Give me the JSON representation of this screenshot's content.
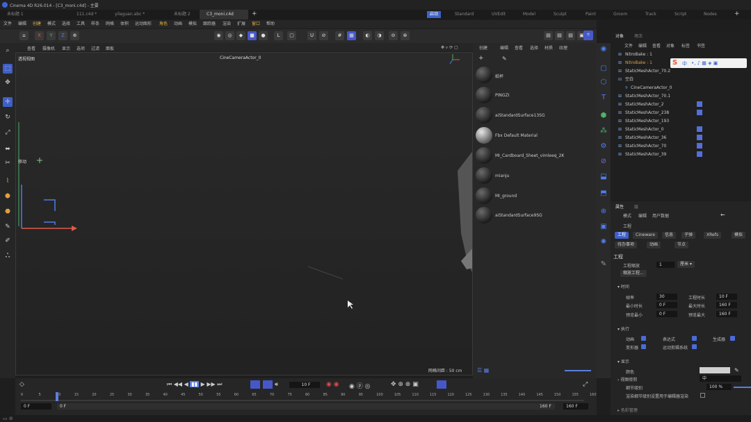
{
  "window_title": "Cinema 4D R26.014 - [C3_moni.c4d] - 主要",
  "doc_tabs": [
    {
      "label": "未标题 1",
      "active": false
    },
    {
      "label": "111.c4d *",
      "active": false
    },
    {
      "label": "yilaguan.abc *",
      "active": false
    },
    {
      "label": "未标题 2",
      "active": false
    },
    {
      "label": "C3_moni.c4d",
      "active": true
    }
  ],
  "layouts": [
    {
      "label": "启动",
      "active": true
    },
    {
      "label": "Standard",
      "active": false
    },
    {
      "label": "UVEdit",
      "active": false
    },
    {
      "label": "Model",
      "active": false
    },
    {
      "label": "Sculpt",
      "active": false
    },
    {
      "label": "Paint",
      "active": false
    },
    {
      "label": "Groom",
      "active": false
    },
    {
      "label": "Track",
      "active": false
    },
    {
      "label": "Script",
      "active": false
    },
    {
      "label": "Nodes",
      "active": false
    }
  ],
  "menu": [
    "文件",
    "编辑",
    "创建",
    "模式",
    "选择",
    "工具",
    "样条",
    "网格",
    "体积",
    "运动图形",
    "角色",
    "动画",
    "模拟",
    "跟踪器",
    "渲染",
    "扩展",
    "窗口",
    "帮助"
  ],
  "axis_labels": {
    "x": "X",
    "y": "Y",
    "z": "Z"
  },
  "viewport": {
    "menu": [
      "查看",
      "摄像机",
      "显示",
      "选项",
      "过滤",
      "面板"
    ],
    "title": "透视视图",
    "camera": "CineCameraActor_0",
    "grid_spacing": "网格间距 : 50 cm",
    "move_label": "移动"
  },
  "material_menu": [
    "创建",
    "编辑",
    "查看",
    "选择",
    "材质",
    "纹理"
  ],
  "materials": [
    {
      "name": "纸杯",
      "light": false
    },
    {
      "name": "PINGZI",
      "light": false
    },
    {
      "name": "aiStandardSurface13SG",
      "light": false
    },
    {
      "name": "Fbx Default Material",
      "light": true
    },
    {
      "name": "MI_Cardboard_Sheet_vimleeq_2K",
      "light": false
    },
    {
      "name": "mianju",
      "light": false
    },
    {
      "name": "MI_ground",
      "light": false
    },
    {
      "name": "aiStandardSurface9SG",
      "light": false
    }
  ],
  "object_panel": {
    "tabs": [
      "对象",
      "场次"
    ],
    "menu": [
      "文件",
      "编辑",
      "查看",
      "对象",
      "标签",
      "书签"
    ],
    "objects": [
      "NitroBake : 1",
      "NitroBake : 1",
      "StaticMeshActor_70.2",
      "空白",
      "CineCameraActor_0",
      "StaticMeshActor_70.1",
      "StaticMeshActor_2",
      "StaticMeshActor_238",
      "StaticMeshActor_193",
      "StaticMeshActor_0",
      "StaticMeshActor_36",
      "StaticMeshActor_70",
      "StaticMeshActor_39"
    ]
  },
  "ime_bar": {
    "logo": "S",
    "text": "中"
  },
  "attributes": {
    "tab": "属性",
    "tab2": "层",
    "menu": [
      "模式",
      "编辑",
      "用户数据"
    ],
    "obj": "工程",
    "tabs": [
      "工程",
      "Cineware",
      "信息",
      "子弹",
      "XRefs",
      "模拟",
      "待办事项",
      "动画",
      "节点"
    ],
    "section": "工程",
    "scale_label": "工程缩放",
    "scale_value": "1",
    "scale_unit": "厘米",
    "scale_button": "缩放工程...",
    "time_section": "时间",
    "fps_label": "帧率",
    "fps_value": "30",
    "duration_label": "工程时长",
    "duration_value": "10 F",
    "min_label": "最小时长",
    "min_value": "0 F",
    "max_label": "最大时长",
    "max_value": "160 F",
    "prev_min_label": "预览最小",
    "prev_min_value": "0 F",
    "prev_max_label": "预览最大",
    "prev_max_value": "160 F",
    "exec_section": "执行",
    "anim_label": "动画",
    "expr_label": "表达式",
    "gen_label": "生成器",
    "deform_label": "变形器",
    "motion_label": "运动剪辑系统",
    "display_section": "显示",
    "color_label": "颜色",
    "lod_label": "视图修剪",
    "lod_value": "中",
    "detail_label": "细节级别",
    "detail_value": "100 %",
    "note": "渲染细节级别设置用于编辑器渲染",
    "anim_sub": "色彩管理"
  },
  "timeline": {
    "frame": "10 F",
    "start": "0 F",
    "start2": "0 F",
    "end": "160 F",
    "end2": "160 F",
    "ticks": [
      "0",
      "5",
      "10",
      "15",
      "20",
      "25",
      "30",
      "35",
      "40",
      "45",
      "50",
      "55",
      "60",
      "65",
      "70",
      "75",
      "80",
      "85",
      "90",
      "95",
      "100",
      "105",
      "110",
      "115",
      "120",
      "125",
      "130",
      "135",
      "140",
      "145",
      "150",
      "155",
      "160"
    ]
  },
  "colors": {
    "accent": "#3f5fc8",
    "x_axis": "#e05a4a",
    "y_axis": "#4fb06a",
    "z_axis": "#4a7ee8"
  }
}
